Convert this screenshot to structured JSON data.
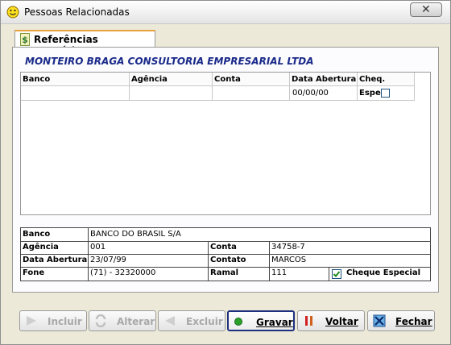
{
  "window": {
    "title": "Pessoas Relacionadas",
    "icon": "smiley-icon"
  },
  "tab": {
    "label": "Referências Bancárias",
    "icon": "dollar-icon"
  },
  "company": "MONTEIRO BRAGA CONSULTORIA EMPRESARIAL LTDA",
  "grid": {
    "headers": [
      "Banco",
      "Agência",
      "Conta",
      "Data Abertura",
      "Cheq. Espec."
    ],
    "rows": [
      {
        "banco": "",
        "agencia": "",
        "conta": "",
        "data_abertura": "00/00/00",
        "cheq_espec": false
      }
    ]
  },
  "detail": {
    "banco_label": "Banco",
    "banco_value": "BANCO DO BRASIL S/A",
    "agencia_label": "Agência",
    "agencia_value": "001",
    "conta_label": "Conta",
    "conta_value": "34758-7",
    "data_label": "Data Abertura",
    "data_value": "23/07/99",
    "contato_label": "Contato",
    "contato_value": "MARCOS",
    "fone_label": "Fone",
    "fone_value": "(71) - 32320000",
    "ramal_label": "Ramal",
    "ramal_value": "111",
    "cheque_label": "Cheque Especial",
    "cheque_checked": true
  },
  "buttons": {
    "incluir": "Incluir",
    "alterar": "Alterar",
    "excluir": "Excluir",
    "gravar": "Gravar",
    "voltar": "Voltar",
    "fechar": "Fechar"
  }
}
